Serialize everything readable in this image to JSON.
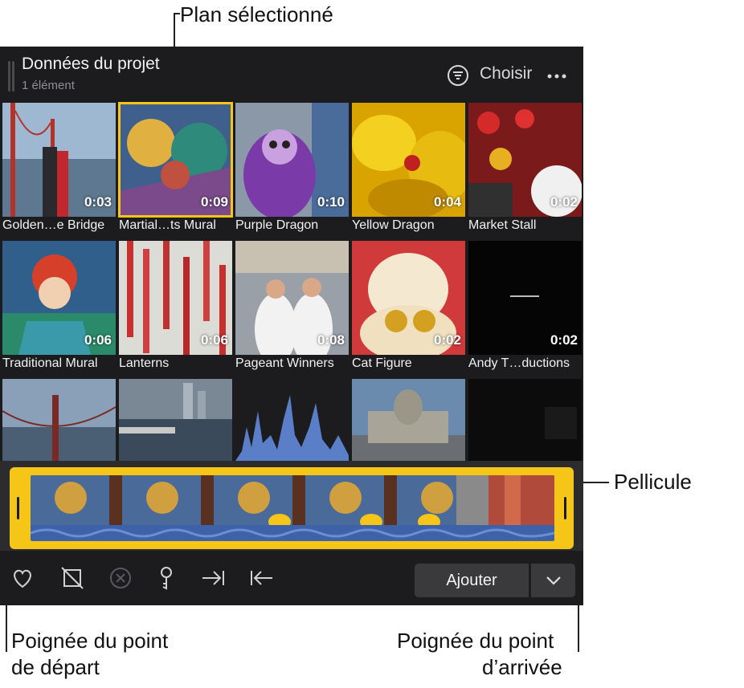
{
  "callouts": {
    "selected_clip": "Plan sélectionné",
    "filmstrip": "Pellicule",
    "start_handle_line1": "Poignée du point",
    "start_handle_line2": "de départ",
    "end_handle_line1": "Poignée du point",
    "end_handle_line2": "d’arrivée"
  },
  "header": {
    "title": "Données du projet",
    "subtitle": "1 élément",
    "choose_label": "Choisir",
    "icons": [
      "filter-icon",
      "more-icon"
    ]
  },
  "clips": [
    {
      "name": "Golden…e Bridge",
      "duration": "0:03",
      "selected": false
    },
    {
      "name": "Martial…ts Mural",
      "duration": "0:09",
      "selected": true
    },
    {
      "name": "Purple Dragon",
      "duration": "0:10",
      "selected": false
    },
    {
      "name": "Yellow Dragon",
      "duration": "0:04",
      "selected": false
    },
    {
      "name": "Market Stall",
      "duration": "0:02",
      "selected": false
    },
    {
      "name": "Traditional Mural",
      "duration": "0:06",
      "selected": false
    },
    {
      "name": "Lanterns",
      "duration": "0:06",
      "selected": false
    },
    {
      "name": "Pageant Winners",
      "duration": "0:08",
      "selected": false
    },
    {
      "name": "Cat Figure",
      "duration": "0:02",
      "selected": false
    },
    {
      "name": "Andy T…ductions",
      "duration": "0:02",
      "selected": false
    }
  ],
  "toolbar": {
    "add_label": "Ajouter",
    "icons": [
      "favorite-heart-icon",
      "reject-icon",
      "clear-rating-icon",
      "keyword-icon",
      "set-end-icon",
      "set-start-icon",
      "chevron-down-icon"
    ]
  },
  "colors": {
    "selection": "#f5c518",
    "panel_bg": "#1c1c1e",
    "waveform": "#4a76c8"
  }
}
